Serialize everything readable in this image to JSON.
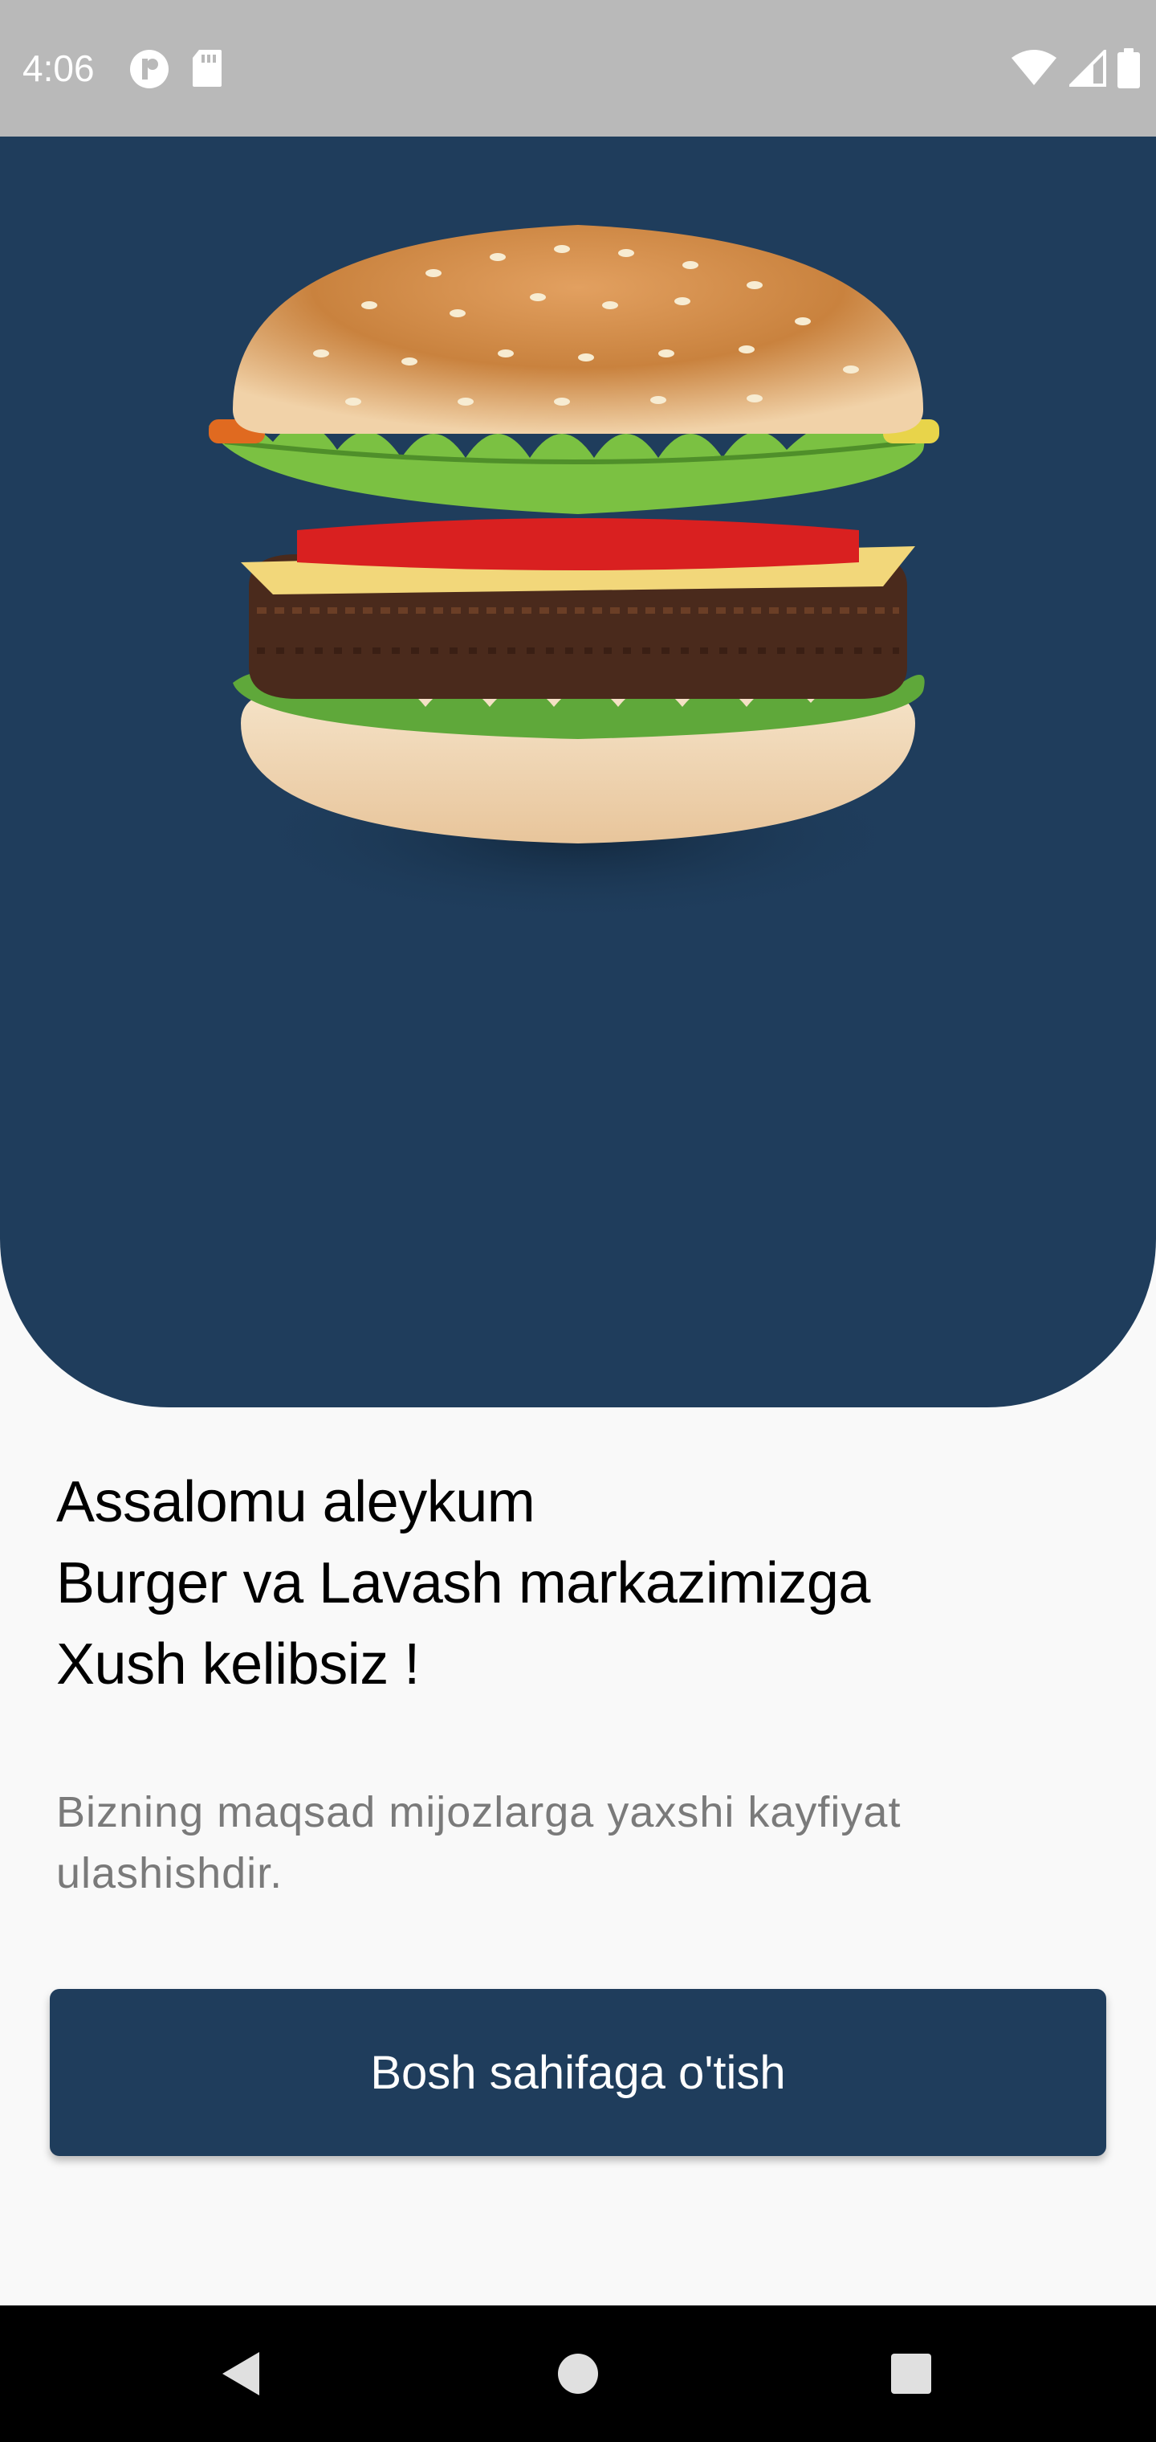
{
  "status_bar": {
    "time": "4:06",
    "left_icons": [
      "app-notification-icon",
      "sd-card-icon"
    ],
    "right_icons": [
      "wifi-icon",
      "cell-signal-icon",
      "battery-icon"
    ],
    "background_color": "#b9b9b9"
  },
  "hero": {
    "background_color": "#1f3d5c",
    "image": "burger-image"
  },
  "welcome": {
    "line1": "Assalomu aleykum",
    "line2": "Burger va Lavash markazimizga",
    "line3": "Xush kelibsiz !"
  },
  "subtitle": {
    "line1": "Bizning maqsad mijozlarga yaxshi kayfiyat",
    "line2": "ulashishdir."
  },
  "cta": {
    "label": "Bosh sahifaga o'tish",
    "background_color": "#1f3d5c"
  },
  "nav_bar": {
    "buttons": [
      "back-icon",
      "home-icon",
      "recents-icon"
    ]
  }
}
